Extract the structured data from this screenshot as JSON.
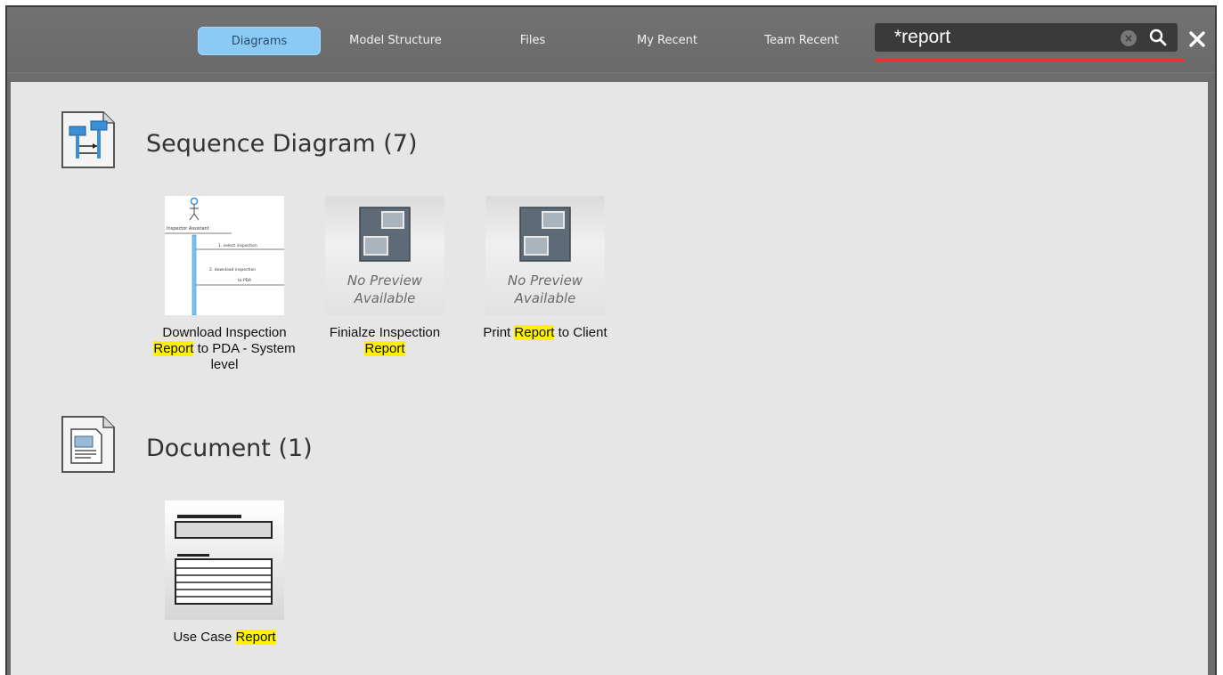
{
  "tabs": [
    {
      "label": "Diagrams",
      "active": true
    },
    {
      "label": "Model Structure",
      "active": false
    },
    {
      "label": "Files",
      "active": false
    },
    {
      "label": "My Recent",
      "active": false
    },
    {
      "label": "Team Recent",
      "active": false
    }
  ],
  "search": {
    "value": "*report"
  },
  "groups": [
    {
      "title": "Sequence Diagram (7)",
      "icon": "sequence-diagram-icon",
      "items": [
        {
          "label_parts": [
            "Download Inspection ",
            "Report",
            " to PDA - System level"
          ],
          "preview": "sequence-thumbnail",
          "thumb_text": [
            "Inspector Assistant",
            "1. select inspection",
            "2. download inspection",
            "to PDA"
          ]
        },
        {
          "label_parts": [
            "Finialze Inspection ",
            "Report",
            ""
          ],
          "preview": "none",
          "no_preview_text": [
            "No Preview",
            "Available"
          ]
        },
        {
          "label_parts": [
            "Print ",
            "Report",
            " to Client"
          ],
          "preview": "none",
          "no_preview_text": [
            "No Preview",
            "Available"
          ]
        }
      ]
    },
    {
      "title": "Document (1)",
      "icon": "document-icon",
      "items": [
        {
          "label_parts": [
            "Use Case ",
            "Report",
            ""
          ],
          "preview": "document-thumbnail"
        }
      ]
    }
  ],
  "colors": {
    "accent_tab": "#8ccaf6",
    "highlight": "#fff200",
    "search_underline": "#e03636"
  }
}
